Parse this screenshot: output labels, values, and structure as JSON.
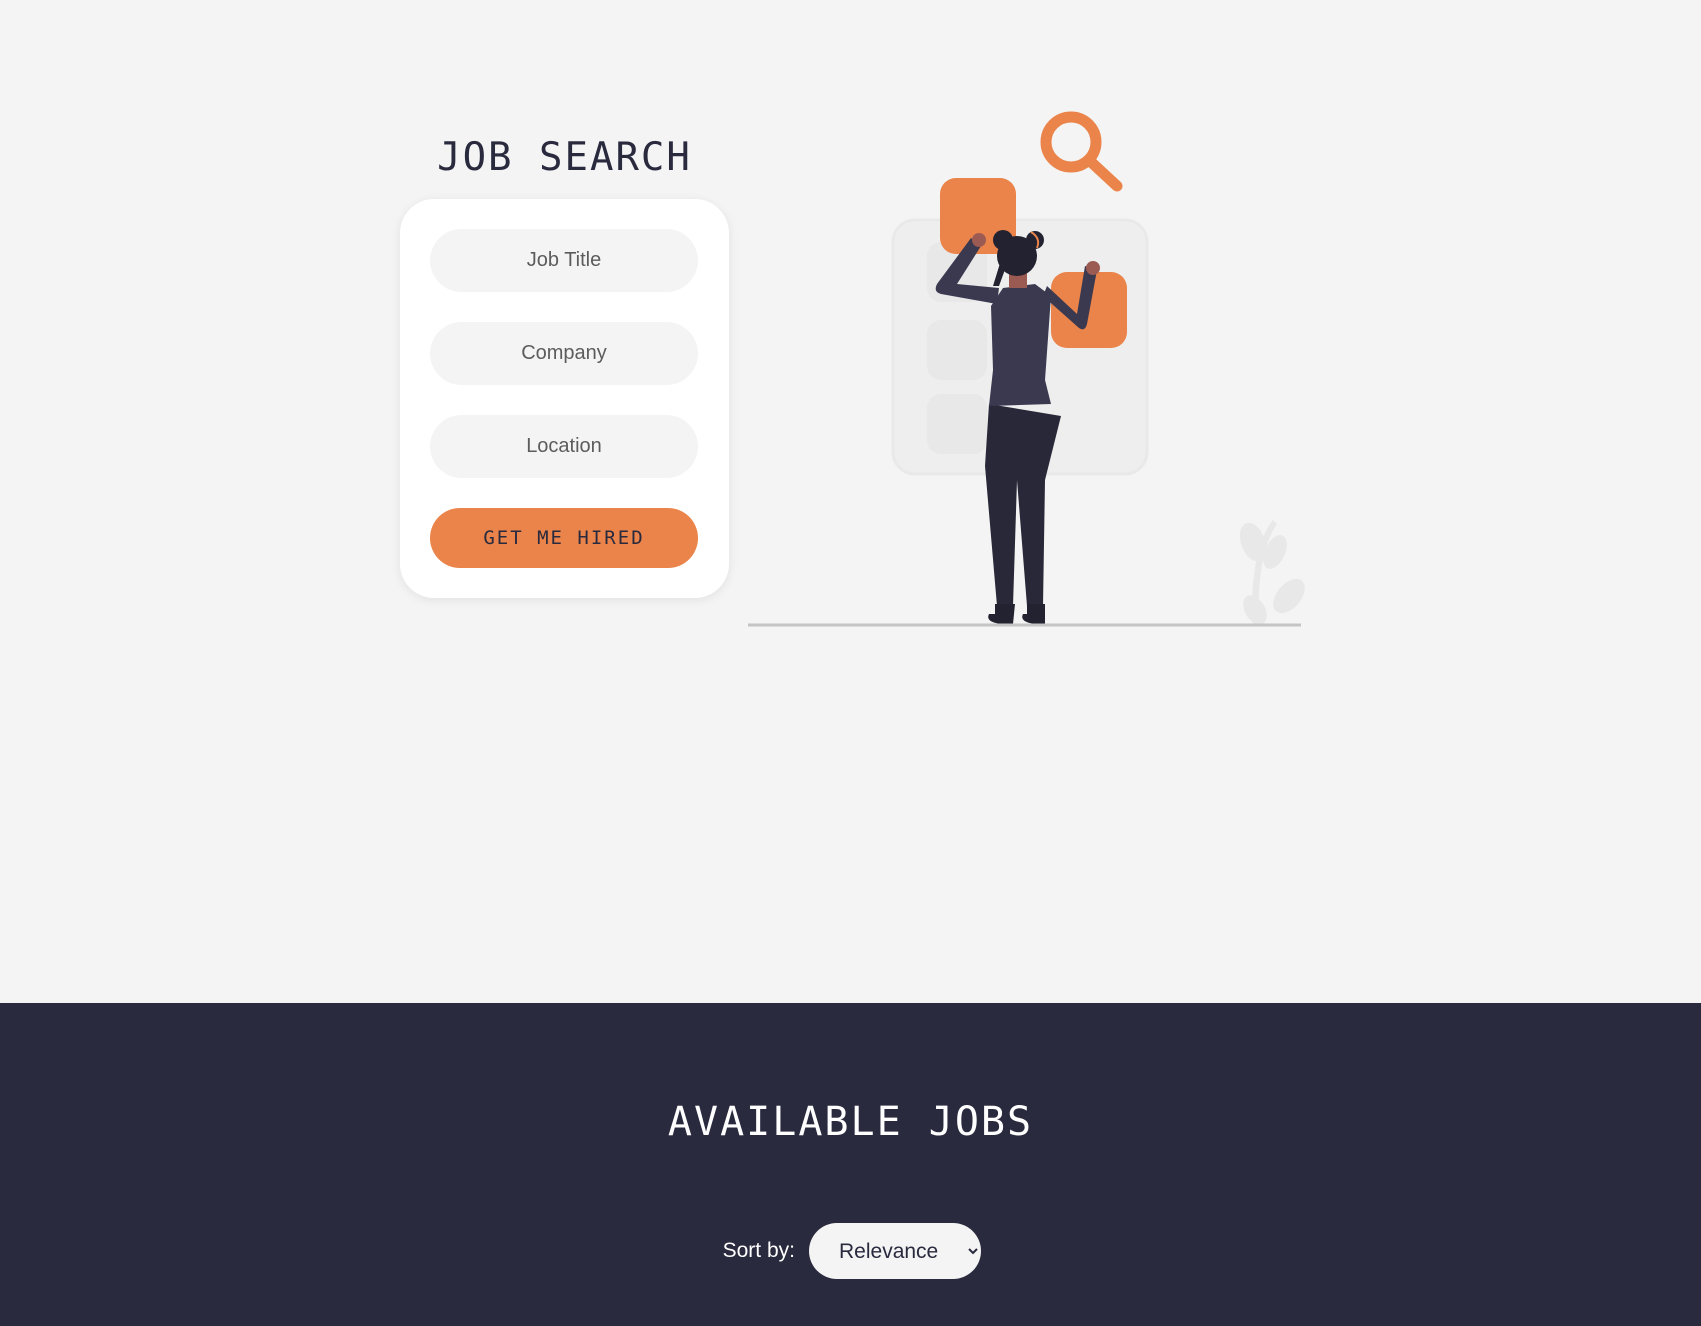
{
  "search": {
    "title": "JOB SEARCH",
    "job_title_placeholder": "Job Title",
    "company_placeholder": "Company",
    "location_placeholder": "Location",
    "submit_label": "GET ME HIRED"
  },
  "jobs": {
    "title": "AVAILABLE JOBS",
    "sort_label": "Sort by:",
    "sort_options": [
      "Relevance"
    ],
    "sort_selected": "Relevance"
  },
  "colors": {
    "accent": "#ea844a",
    "dark": "#292a3e",
    "background": "#f4f4f4",
    "card": "#ffffff"
  },
  "illustration": {
    "icon": "woman-arranging-tiles-with-magnifier-illustration"
  }
}
